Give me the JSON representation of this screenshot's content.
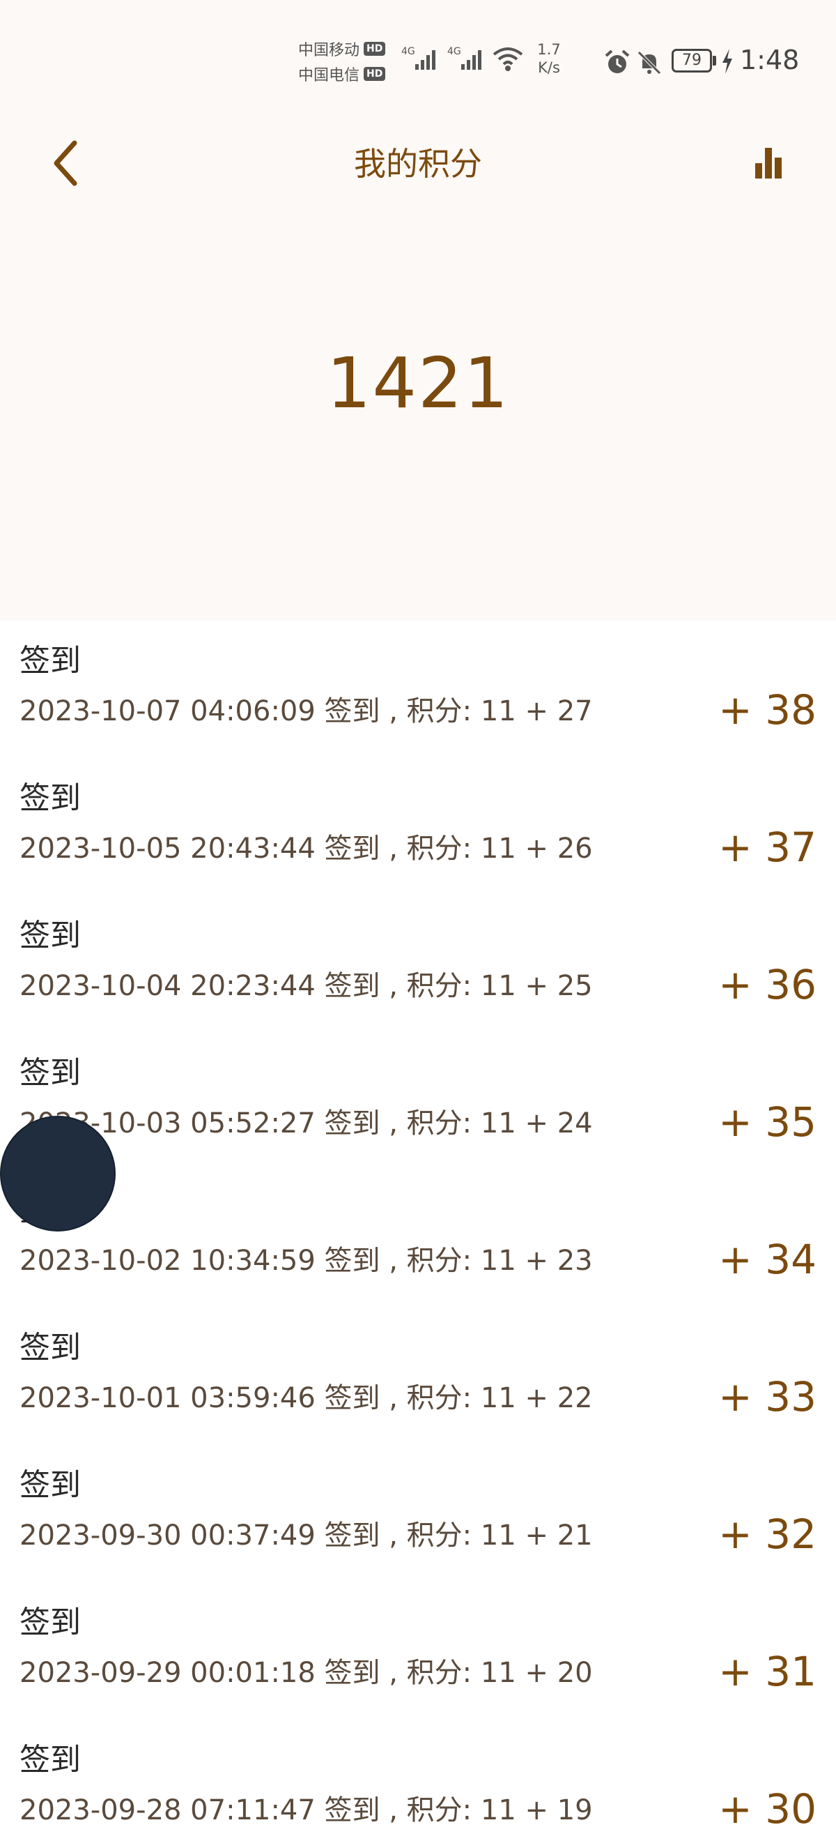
{
  "status_bar": {
    "carrier1": "中国移动",
    "carrier2": "中国电信",
    "hd": "HD",
    "net_type1": "4G",
    "net_type2": "4G",
    "net_speed_value": "1.7",
    "net_speed_unit": "K/s",
    "battery": "79",
    "time": "1:48",
    "icons": [
      "signal-icon",
      "wifi-icon",
      "alarm-icon",
      "mute-icon",
      "battery-icon",
      "charging-icon"
    ]
  },
  "header": {
    "title": "我的积分",
    "back_icon": "back-arrow-icon",
    "stats_icon": "bar-chart-icon"
  },
  "points": {
    "total": "1421"
  },
  "records": [
    {
      "title": "签到",
      "description": "2023-10-07 04:06:09 签到 , 积分:  11 + 27",
      "delta": "+ 38"
    },
    {
      "title": "签到",
      "description": "2023-10-05 20:43:44 签到 , 积分:  11 + 26",
      "delta": "+ 37"
    },
    {
      "title": "签到",
      "description": "2023-10-04 20:23:44 签到 , 积分:  11 + 25",
      "delta": "+ 36"
    },
    {
      "title": "签到",
      "description": "2023-10-03 05:52:27 签到 , 积分:  11 + 24",
      "delta": "+ 35"
    },
    {
      "title": "签到",
      "description": "2023-10-02 10:34:59 签到 , 积分:  11 + 23",
      "delta": "+ 34"
    },
    {
      "title": "签到",
      "description": "2023-10-01 03:59:46 签到 , 积分:  11 + 22",
      "delta": "+ 33"
    },
    {
      "title": "签到",
      "description": "2023-09-30 00:37:49 签到 , 积分:  11 + 21",
      "delta": "+ 32"
    },
    {
      "title": "签到",
      "description": "2023-09-29 00:01:18 签到 , 积分:  11 + 20",
      "delta": "+ 31"
    },
    {
      "title": "签到",
      "description": "2023-09-28 07:11:47 签到 , 积分:  11 + 19",
      "delta": "+ 30"
    }
  ],
  "colors": {
    "accent": "#7b4a0e",
    "header_bg": "#fdf9f6",
    "floating_ball": "#1f2d3f"
  }
}
